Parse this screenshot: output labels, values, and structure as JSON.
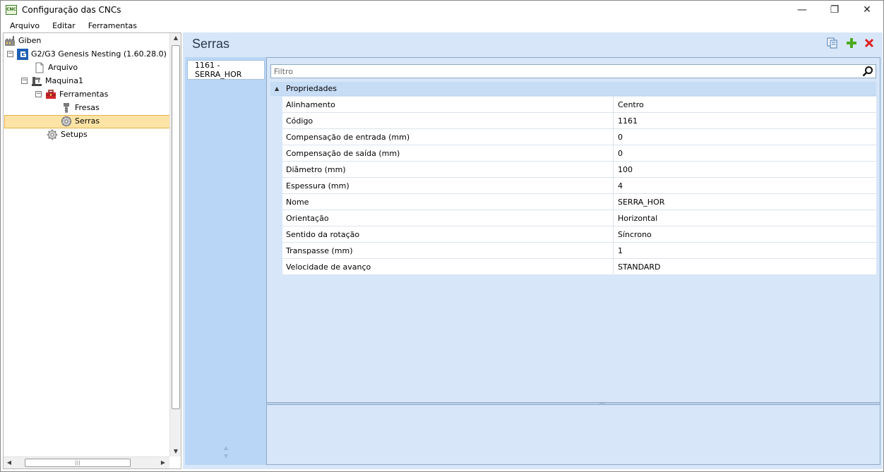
{
  "window": {
    "title": "Configuração das CNCs",
    "app_icon_text": "CNC",
    "controls": {
      "minimize": "—",
      "restore": "❐",
      "close": "✕"
    }
  },
  "menu": [
    "Arquivo",
    "Editar",
    "Ferramentas"
  ],
  "tree": {
    "root": "Giben",
    "machine_group": "G2/G3 Genesis Nesting (1.60.28.0)",
    "arquivo": "Arquivo",
    "maquina": "Maquina1",
    "ferramentas": "Ferramentas",
    "fresas": "Fresas",
    "serras": "Serras",
    "setups": "Setups",
    "selected": "Serras",
    "expander_symbol": "−",
    "scroll": {
      "up": "▲",
      "down": "▼",
      "left": "◀",
      "right": "▶",
      "grip": "|||"
    }
  },
  "pane": {
    "title": "Serras",
    "toolbar": {
      "copy_icon": "copy-icon",
      "add_icon": "add-icon",
      "delete_icon": "delete-icon"
    },
    "list": [
      "1161 - SERRA_HOR"
    ],
    "list_scroll": {
      "up": "▲",
      "down": "▼"
    }
  },
  "filter": {
    "placeholder": "Filtro",
    "value": ""
  },
  "properties": {
    "category": "Propriedades",
    "category_chevron": "▲",
    "rows": [
      {
        "name": "Alinhamento",
        "value": "Centro"
      },
      {
        "name": "Código",
        "value": "1161"
      },
      {
        "name": "Compensação de entrada (mm)",
        "value": "0"
      },
      {
        "name": "Compensação de saída (mm)",
        "value": "0"
      },
      {
        "name": "Diâmetro (mm)",
        "value": "100"
      },
      {
        "name": "Espessura (mm)",
        "value": "4"
      },
      {
        "name": "Nome",
        "value": "SERRA_HOR"
      },
      {
        "name": "Orientação",
        "value": "Horizontal"
      },
      {
        "name": "Sentido da rotação",
        "value": "Síncrono"
      },
      {
        "name": "Transpasse (mm)",
        "value": "1"
      },
      {
        "name": "Velocidade de avanço",
        "value": "STANDARD"
      }
    ]
  },
  "colors": {
    "selection_bg": "#fde4a6",
    "pane_bg": "#d7e6f8",
    "list_bg": "#b9d6f6",
    "delete_red": "#e02020",
    "add_green": "#4caa1f"
  }
}
